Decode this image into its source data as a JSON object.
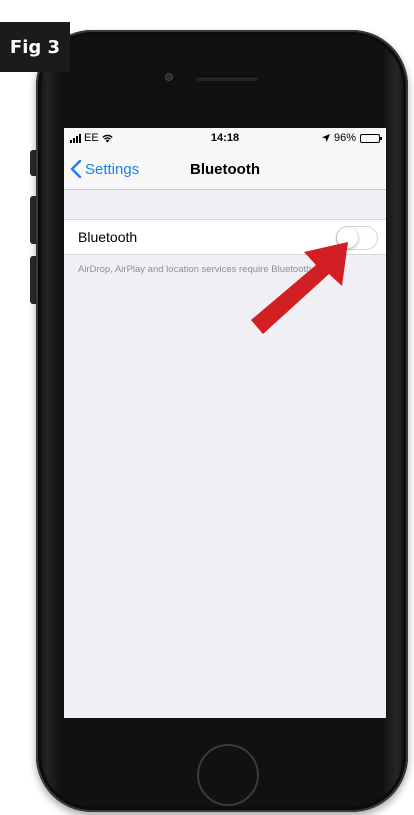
{
  "figure_label": "Fig 3",
  "status_bar": {
    "carrier": "EE",
    "time": "14:18",
    "battery": "96%",
    "battery_level": 0.96
  },
  "nav": {
    "back_label": "Settings",
    "title": "Bluetooth"
  },
  "bluetooth_cell": {
    "label": "Bluetooth",
    "toggle_on": false
  },
  "footnote": "AirDrop, AirPlay and location services require Bluetooth.",
  "colors": {
    "ios_blue": "#1a7ff2",
    "arrow_red": "#d21f24",
    "screen_bg": "#efeff4"
  },
  "icons": [
    "signal-bars-icon",
    "wifi-icon",
    "location-arrow-icon",
    "battery-icon",
    "chevron-left-icon",
    "red-pointer-arrow-icon"
  ]
}
